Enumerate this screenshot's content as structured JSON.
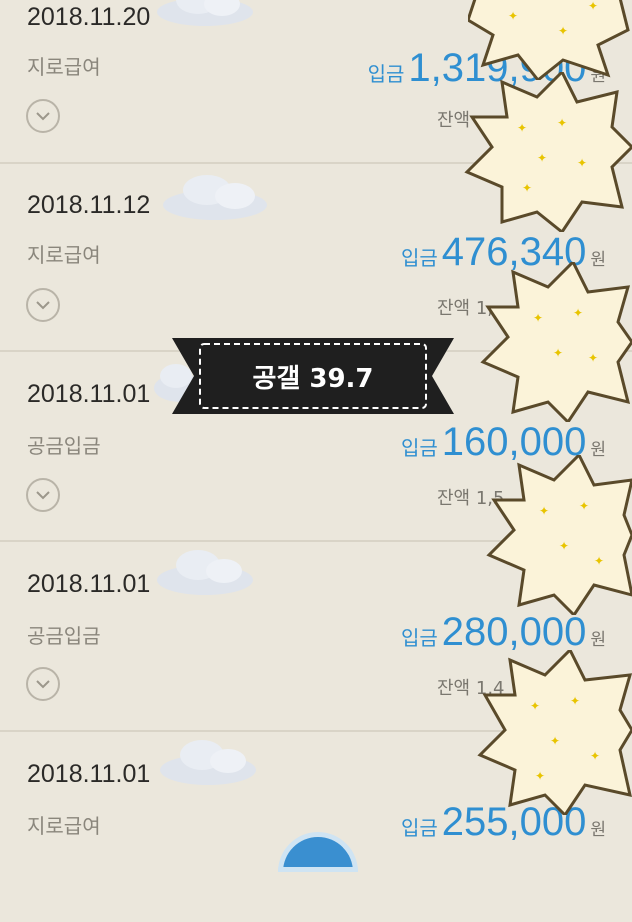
{
  "transactions": [
    {
      "date": "2018.11.20",
      "desc": "지로급여",
      "type": "입금",
      "amount": "1,319,900",
      "unit": "원",
      "balance": "잔액"
    },
    {
      "date": "2018.11.12",
      "desc": "지로급여",
      "type": "입금",
      "amount": "476,340",
      "unit": "원",
      "balance": "잔액 1,"
    },
    {
      "date": "2018.11.01",
      "desc": "공금입금",
      "type": "입금",
      "amount": "160,000",
      "unit": "원",
      "balance": "잔액 1,5"
    },
    {
      "date": "2018.11.01",
      "desc": "공금입금",
      "type": "입금",
      "amount": "280,000",
      "unit": "원",
      "balance": "잔액 1,4"
    },
    {
      "date": "2018.11.01",
      "desc": "지로급여",
      "type": "입금",
      "amount": "255,000",
      "unit": "원",
      "balance": ""
    }
  ],
  "overlay": {
    "badge_text": "공갤 39.7"
  },
  "icons": {
    "expand": "chevron-down-icon",
    "cloud": "cloud-sticker-icon",
    "bubble": "star-burst-sticker-icon"
  },
  "colors": {
    "accent": "#2f8fd1",
    "background": "#ebe7dc"
  }
}
